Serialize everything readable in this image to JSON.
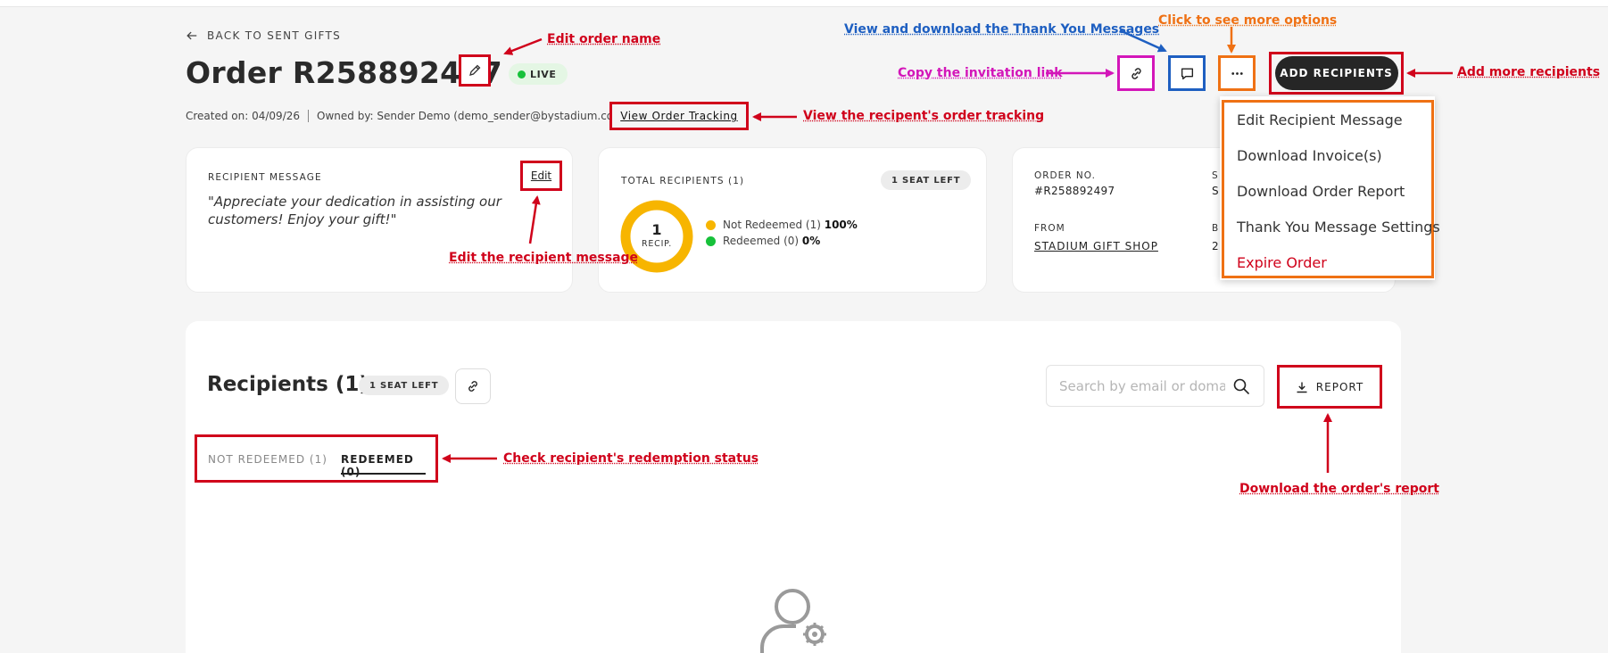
{
  "header": {
    "back_label": "BACK TO SENT GIFTS",
    "order_title": "Order R258892497",
    "status": "LIVE",
    "created_on": "Created on: 04/09/26",
    "owned_by": "Owned by: Sender Demo (demo_sender@bystadium.com)",
    "view_tracking": "View Order Tracking",
    "add_recipients": "ADD RECIPIENTS"
  },
  "recipient_message": {
    "label": "RECIPIENT MESSAGE",
    "edit": "Edit",
    "text": "\"Appreciate your dedication in assisting our customers! Enjoy your gift!\""
  },
  "recipients_summary": {
    "label": "TOTAL RECIPIENTS (1)",
    "seats_left": "1 SEAT LEFT",
    "donut_count": "1",
    "donut_unit": "RECIP.",
    "legend": [
      {
        "label": "Not Redeemed (1)",
        "pct": "100%",
        "color": "#f7b500"
      },
      {
        "label": "Redeemed (0)",
        "pct": "0%",
        "color": "#17c13a"
      }
    ]
  },
  "order_info": {
    "order_no_label": "ORDER NO.",
    "order_no": "#R258892497",
    "from_label": "FROM",
    "from": "STADIUM GIFT SHOP",
    "col2_label_partial": "S",
    "col2_value_partial": "S",
    "col2b_label_partial": "B",
    "col2b_value_partial": "2"
  },
  "more_menu": [
    {
      "label": "Edit Recipient Message",
      "danger": false
    },
    {
      "label": "Download Invoice(s)",
      "danger": false
    },
    {
      "label": "Download Order Report",
      "danger": false
    },
    {
      "label": "Thank You Message Settings",
      "danger": false
    },
    {
      "label": "Expire Order",
      "danger": true
    }
  ],
  "recipients_panel": {
    "title": "Recipients (1)",
    "seats_left": "1 SEAT LEFT",
    "search_placeholder": "Search by email or domain",
    "report": "REPORT",
    "tabs": [
      {
        "label": "NOT REDEEMED (1)",
        "active": false
      },
      {
        "label": "REDEEMED (0)",
        "active": true
      }
    ]
  },
  "annotations": {
    "edit_order_name": "Edit order name",
    "view_download_thanks": "View and download the Thank You Messages",
    "more_options": "Click to see more options",
    "copy_link": "Copy the invitation link",
    "add_more": "Add more recipients",
    "view_tracking": "View the recipent's order tracking",
    "edit_message": "Edit the recipient message",
    "redemption_status": "Check recipient's redemption status",
    "download_report": "Download the order's report"
  },
  "colors": {
    "annotation_red": "#d0021b",
    "annotation_blue": "#1e5fc1",
    "annotation_pink": "#d316b9",
    "annotation_orange": "#ef7114",
    "live_green": "#17c13a",
    "donut_yellow": "#f7b500"
  }
}
